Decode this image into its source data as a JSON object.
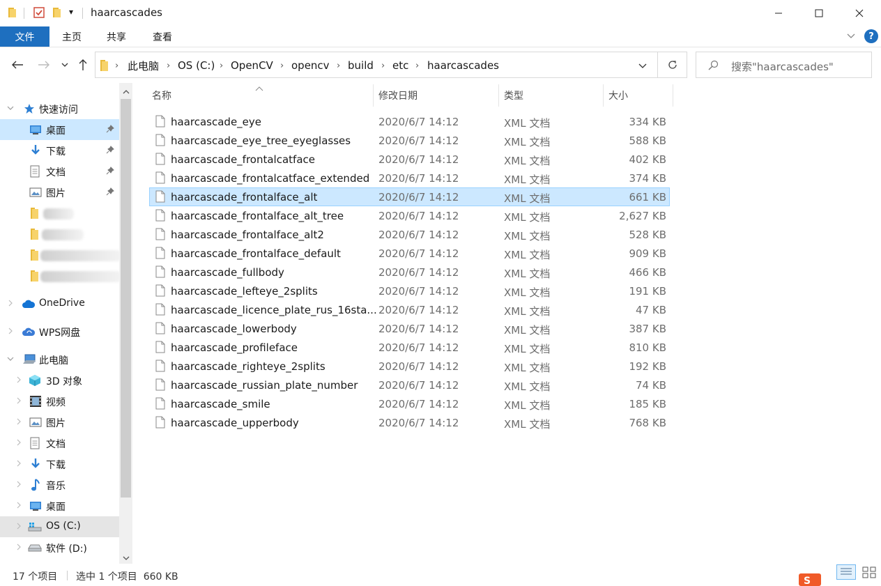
{
  "window": {
    "title": "haarcascades",
    "minimize_glyph": "—",
    "maximize_glyph": "☐",
    "close_glyph": "✕"
  },
  "quick_access": {
    "dropdown_glyph": "▾"
  },
  "ribbon": {
    "tabs": [
      "文件",
      "主页",
      "共享",
      "查看"
    ],
    "help_glyph": "?"
  },
  "address": {
    "crumbs": [
      "此电脑",
      "OS (C:)",
      "OpenCV",
      "opencv",
      "build",
      "etc",
      "haarcascades"
    ],
    "separator": "›"
  },
  "search": {
    "placeholder": "搜索\"haarcascades\""
  },
  "sidebar": {
    "quick_access_label": "快速访问",
    "pinned": [
      {
        "label": "桌面",
        "icon": "desktop-icon"
      },
      {
        "label": "下载",
        "icon": "download-icon"
      },
      {
        "label": "文档",
        "icon": "document-icon"
      },
      {
        "label": "图片",
        "icon": "pictures-icon"
      }
    ],
    "onedrive_label": "OneDrive",
    "wps_label": "WPS网盘",
    "this_pc_label": "此电脑",
    "pc_items": [
      {
        "label": "3D 对象",
        "icon": "3d-objects-icon"
      },
      {
        "label": "视频",
        "icon": "video-icon"
      },
      {
        "label": "图片",
        "icon": "pictures-icon"
      },
      {
        "label": "文档",
        "icon": "document-icon"
      },
      {
        "label": "下载",
        "icon": "download-icon"
      },
      {
        "label": "音乐",
        "icon": "music-icon"
      },
      {
        "label": "桌面",
        "icon": "desktop-icon"
      },
      {
        "label": "OS (C:)",
        "icon": "windows-drive-icon"
      },
      {
        "label": "软件 (D:)",
        "icon": "drive-icon"
      }
    ]
  },
  "columns": {
    "name": "名称",
    "date": "修改日期",
    "type": "类型",
    "size": "大小"
  },
  "files": [
    {
      "name": "haarcascade_eye",
      "date": "2020/6/7 14:12",
      "type": "XML 文档",
      "size": "334 KB"
    },
    {
      "name": "haarcascade_eye_tree_eyeglasses",
      "date": "2020/6/7 14:12",
      "type": "XML 文档",
      "size": "588 KB"
    },
    {
      "name": "haarcascade_frontalcatface",
      "date": "2020/6/7 14:12",
      "type": "XML 文档",
      "size": "402 KB"
    },
    {
      "name": "haarcascade_frontalcatface_extended",
      "date": "2020/6/7 14:12",
      "type": "XML 文档",
      "size": "374 KB"
    },
    {
      "name": "haarcascade_frontalface_alt",
      "date": "2020/6/7 14:12",
      "type": "XML 文档",
      "size": "661 KB",
      "selected": true
    },
    {
      "name": "haarcascade_frontalface_alt_tree",
      "date": "2020/6/7 14:12",
      "type": "XML 文档",
      "size": "2,627 KB"
    },
    {
      "name": "haarcascade_frontalface_alt2",
      "date": "2020/6/7 14:12",
      "type": "XML 文档",
      "size": "528 KB"
    },
    {
      "name": "haarcascade_frontalface_default",
      "date": "2020/6/7 14:12",
      "type": "XML 文档",
      "size": "909 KB"
    },
    {
      "name": "haarcascade_fullbody",
      "date": "2020/6/7 14:12",
      "type": "XML 文档",
      "size": "466 KB"
    },
    {
      "name": "haarcascade_lefteye_2splits",
      "date": "2020/6/7 14:12",
      "type": "XML 文档",
      "size": "191 KB"
    },
    {
      "name": "haarcascade_licence_plate_rus_16sta...",
      "date": "2020/6/7 14:12",
      "type": "XML 文档",
      "size": "47 KB"
    },
    {
      "name": "haarcascade_lowerbody",
      "date": "2020/6/7 14:12",
      "type": "XML 文档",
      "size": "387 KB"
    },
    {
      "name": "haarcascade_profileface",
      "date": "2020/6/7 14:12",
      "type": "XML 文档",
      "size": "810 KB"
    },
    {
      "name": "haarcascade_righteye_2splits",
      "date": "2020/6/7 14:12",
      "type": "XML 文档",
      "size": "192 KB"
    },
    {
      "name": "haarcascade_russian_plate_number",
      "date": "2020/6/7 14:12",
      "type": "XML 文档",
      "size": "74 KB"
    },
    {
      "name": "haarcascade_smile",
      "date": "2020/6/7 14:12",
      "type": "XML 文档",
      "size": "185 KB"
    },
    {
      "name": "haarcascade_upperbody",
      "date": "2020/6/7 14:12",
      "type": "XML 文档",
      "size": "768 KB"
    }
  ],
  "status": {
    "item_count": "17 个项目",
    "selection": "选中 1 个项目  660 KB"
  },
  "colors": {
    "accent": "#1e6fbf",
    "selection_bg": "#cce8ff",
    "selection_border": "#99d1ff",
    "folder": "#f5c542"
  }
}
